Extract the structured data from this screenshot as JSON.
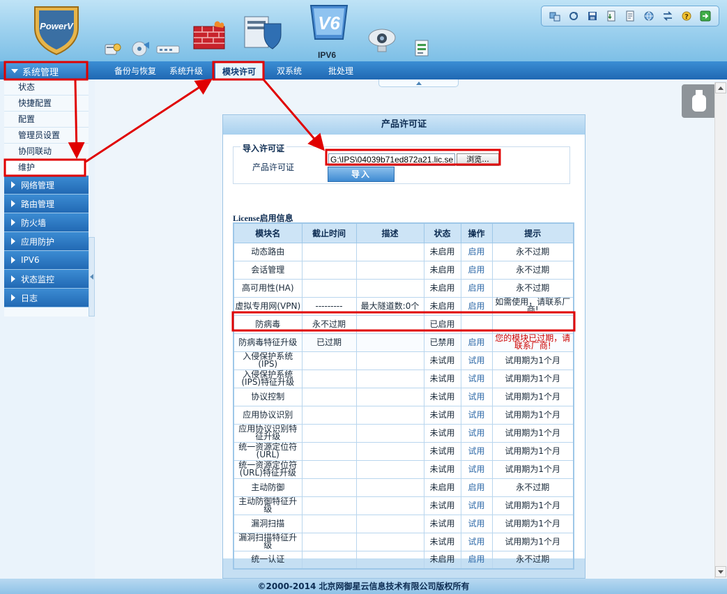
{
  "header": {
    "logo_text": "PowerV",
    "ipv6_label": "IPV6",
    "icons": [
      "user-security-icon",
      "disc-settings-icon",
      "network-device-icon",
      "firewall-icon",
      "server-shield-icon",
      "v6-logo-icon",
      "camera-monitor-icon",
      "report-sheet-icon"
    ],
    "toolbar_icons": [
      "network-tool-icon",
      "refresh-icon",
      "save-icon",
      "import-export-icon",
      "document-icon",
      "globe-icon",
      "exchange-icon",
      "help-icon",
      "exit-icon"
    ]
  },
  "nav": {
    "section_label": "系统管理",
    "tabs": [
      "备份与恢复",
      "系统升级",
      "模块许可",
      "双系统",
      "批处理"
    ]
  },
  "sidebar": {
    "sub_items": [
      "状态",
      "快捷配置",
      "配置",
      "管理员设置",
      "协同联动",
      "维护"
    ],
    "groups": [
      "网络管理",
      "路由管理",
      "防火墙",
      "应用防护",
      "IPV6",
      "状态监控",
      "日志"
    ]
  },
  "panel": {
    "title": "产品许可证",
    "import_legend": "导入许可证",
    "license_label": "产品许可证",
    "file_value": "G:\\IPS\\04039b71ed872a21.lic.se",
    "browse_label": "浏览...",
    "import_label": "导入",
    "info_title": "License启用信息"
  },
  "table": {
    "headers": [
      "模块名",
      "截止时间",
      "描述",
      "状态",
      "操作",
      "提示"
    ],
    "rows": [
      {
        "name": "动态路由",
        "deadline": "",
        "desc": "",
        "status": "未启用",
        "op": "启用",
        "hint": "永不过期"
      },
      {
        "name": "会话管理",
        "deadline": "",
        "desc": "",
        "status": "未启用",
        "op": "启用",
        "hint": "永不过期"
      },
      {
        "name": "高可用性(HA)",
        "deadline": "",
        "desc": "",
        "status": "未启用",
        "op": "启用",
        "hint": "永不过期"
      },
      {
        "name": "虚拟专用网(VPN)",
        "deadline": "---------",
        "desc": "最大隧道数:0个",
        "status": "未启用",
        "op": "启用",
        "hint": "如需使用，请联系厂商!"
      },
      {
        "name": "防病毒",
        "deadline": "永不过期",
        "desc": "",
        "status": "已启用",
        "op": "",
        "hint": ""
      },
      {
        "name": "防病毒特征升级",
        "deadline": "已过期",
        "desc": "",
        "status": "已禁用",
        "op": "启用",
        "hint": "您的模块已过期，请联系厂商!"
      },
      {
        "name": "入侵保护系统(IPS)",
        "deadline": "",
        "desc": "",
        "status": "未试用",
        "op": "试用",
        "hint": "试用期为1个月"
      },
      {
        "name": "入侵保护系统(IPS)特征升级",
        "deadline": "",
        "desc": "",
        "status": "未试用",
        "op": "试用",
        "hint": "试用期为1个月"
      },
      {
        "name": "协议控制",
        "deadline": "",
        "desc": "",
        "status": "未试用",
        "op": "试用",
        "hint": "试用期为1个月"
      },
      {
        "name": "应用协议识别",
        "deadline": "",
        "desc": "",
        "status": "未试用",
        "op": "试用",
        "hint": "试用期为1个月"
      },
      {
        "name": "应用协议识别特征升级",
        "deadline": "",
        "desc": "",
        "status": "未试用",
        "op": "试用",
        "hint": "试用期为1个月"
      },
      {
        "name": "统一资源定位符(URL)",
        "deadline": "",
        "desc": "",
        "status": "未试用",
        "op": "试用",
        "hint": "试用期为1个月"
      },
      {
        "name": "统一资源定位符(URL)特征升级",
        "deadline": "",
        "desc": "",
        "status": "未试用",
        "op": "试用",
        "hint": "试用期为1个月"
      },
      {
        "name": "主动防御",
        "deadline": "",
        "desc": "",
        "status": "未启用",
        "op": "启用",
        "hint": "永不过期"
      },
      {
        "name": "主动防御特征升级",
        "deadline": "",
        "desc": "",
        "status": "未试用",
        "op": "试用",
        "hint": "试用期为1个月"
      },
      {
        "name": "漏洞扫描",
        "deadline": "",
        "desc": "",
        "status": "未试用",
        "op": "试用",
        "hint": "试用期为1个月"
      },
      {
        "name": "漏洞扫描特征升级",
        "deadline": "",
        "desc": "",
        "status": "未试用",
        "op": "试用",
        "hint": "试用期为1个月"
      },
      {
        "name": "统一认证",
        "deadline": "",
        "desc": "",
        "status": "未启用",
        "op": "启用",
        "hint": "永不过期"
      }
    ]
  },
  "footer": {
    "text": "©2000-2014 北京网御星云信息技术有限公司版权所有"
  },
  "colors": {
    "brand_blue": "#2269b4",
    "annotation_red": "#e00000",
    "hint_red": "#cc0000"
  }
}
